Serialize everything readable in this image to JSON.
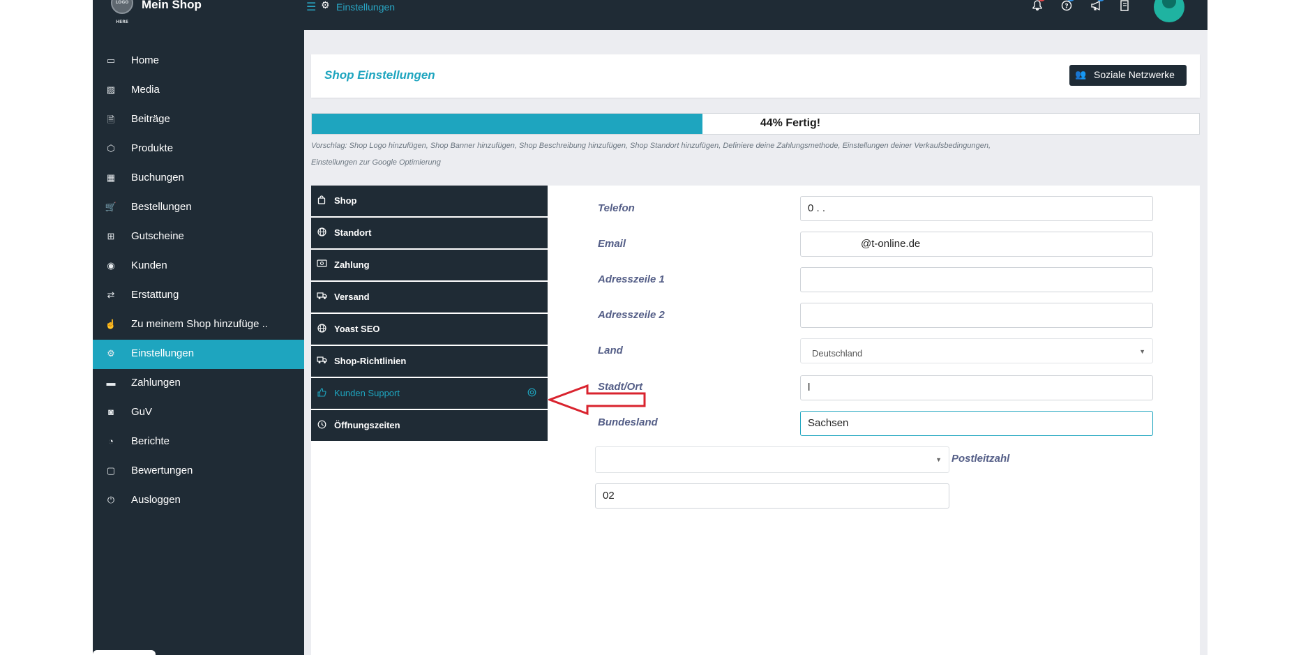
{
  "header": {
    "logo_text": "LOGO HERE",
    "shop_title": "Mein Shop",
    "breadcrumb": "Einstellungen",
    "notification_badge": "1",
    "help_badge": "0",
    "announce_badge": "0"
  },
  "sidebar": {
    "items": [
      {
        "label": "Home",
        "icon": "▭"
      },
      {
        "label": "Media",
        "icon": "▨"
      },
      {
        "label": "Beiträge",
        "icon": "🗎"
      },
      {
        "label": "Produkte",
        "icon": "⬡"
      },
      {
        "label": "Buchungen",
        "icon": "▦"
      },
      {
        "label": "Bestellungen",
        "icon": "🛒"
      },
      {
        "label": "Gutscheine",
        "icon": "⊞"
      },
      {
        "label": "Kunden",
        "icon": "◉"
      },
      {
        "label": "Erstattung",
        "icon": "⇄"
      },
      {
        "label": "Zu meinem Shop hinzufüge ..",
        "icon": "☝"
      },
      {
        "label": "Einstellungen",
        "icon": "⚙"
      },
      {
        "label": "Zahlungen",
        "icon": "▬"
      },
      {
        "label": "GuV",
        "icon": "◙"
      },
      {
        "label": "Berichte",
        "icon": "◔"
      },
      {
        "label": "Bewertungen",
        "icon": "▢"
      },
      {
        "label": "Ausloggen",
        "icon": "⏻"
      }
    ],
    "active_index": 10
  },
  "page": {
    "title": "Shop Einstellungen",
    "social_button": "Soziale Netzwerke"
  },
  "progress": {
    "percent": 44,
    "label": "44% Fertig!"
  },
  "suggestion": "Vorschlag: Shop Logo hinzufügen, Shop Banner hinzufügen, Shop Beschreibung hinzufügen, Shop Standort hinzufügen, Definiere deine Zahlungsmethode, Einstellungen deiner Verkaufsbedingungen, Einstellungen zur Google Optimierung",
  "tabs": [
    {
      "label": "Shop",
      "icon": "shopping-bag-icon"
    },
    {
      "label": "Standort",
      "icon": "globe-icon"
    },
    {
      "label": "Zahlung",
      "icon": "money-icon"
    },
    {
      "label": "Versand",
      "icon": "truck-icon"
    },
    {
      "label": "Yoast SEO",
      "icon": "globe-icon"
    },
    {
      "label": "Shop-Richtlinien",
      "icon": "truck-icon"
    },
    {
      "label": "Kunden Support",
      "icon": "thumbs-up-icon"
    },
    {
      "label": "Öffnungszeiten",
      "icon": "clock-icon"
    }
  ],
  "active_tab_index": 6,
  "form": {
    "telefon_label": "Telefon",
    "telefon_value": "0 .                   .",
    "email_label": "Email",
    "email_value": "@t-online.de",
    "adresse1_label": "Adresszeile 1",
    "adresse1_value": "",
    "adresse2_label": "Adresszeile 2",
    "adresse2_value": "",
    "land_label": "Land",
    "land_value": "Deutschland",
    "stadt_label": "Stadt/Ort",
    "stadt_value": "l",
    "bundesland_label": "Bundesland",
    "bundesland_value": "Sachsen",
    "postleitzahl_label": "Postleitzahl",
    "extra_select_value": "",
    "postleitzahl_value": "02"
  },
  "colors": {
    "accent": "#1ea5bf",
    "sidebar_bg": "#1f2b35",
    "annotation_arrow": "#d9232e"
  }
}
